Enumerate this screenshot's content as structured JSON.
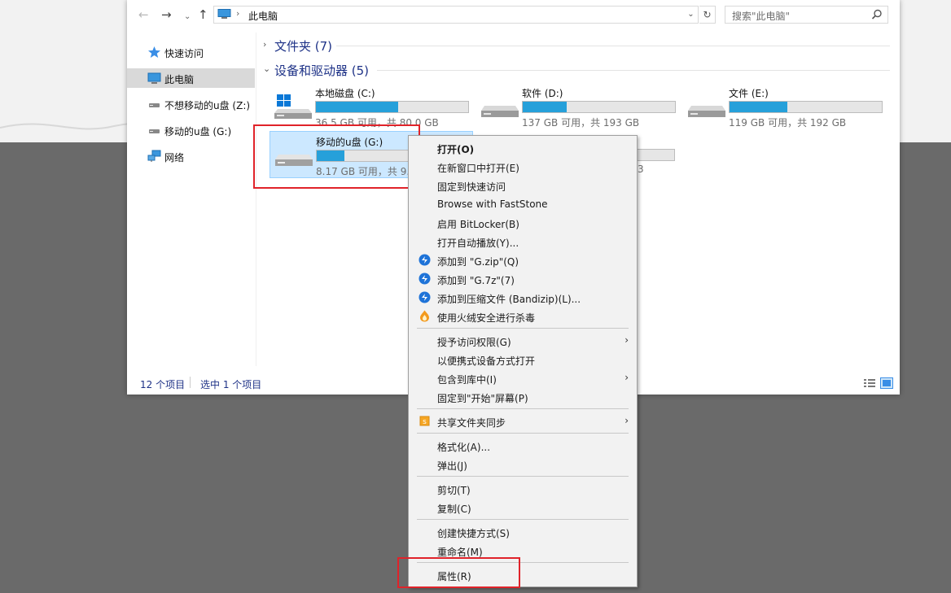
{
  "address": {
    "path": "此电脑",
    "search_placeholder": "搜索\"此电脑\""
  },
  "sidebar": {
    "items": [
      {
        "label": "快速访问"
      },
      {
        "label": "此电脑"
      },
      {
        "label": "不想移动的u盘 (Z:)"
      },
      {
        "label": "移动的u盘 (G:)"
      },
      {
        "label": "网络"
      }
    ]
  },
  "content": {
    "folders_header": "文件夹 (7)",
    "devices_header": "设备和驱动器 (5)",
    "drives": [
      {
        "name": "本地磁盘 (C:)",
        "free": "36.5 GB 可用，共 80.0 GB",
        "used_fraction": 0.54
      },
      {
        "name": "软件 (D:)",
        "free": "137 GB 可用，共 193 GB",
        "used_fraction": 0.29
      },
      {
        "name": "文件 (E:)",
        "free": "119 GB 可用，共 192 GB",
        "used_fraction": 0.38
      },
      {
        "name": "移动的u盘 (G:)",
        "free": "8.17 GB 可用，共 9.9",
        "used_fraction": 0.18
      }
    ],
    "hidden_drive_fragment": "3"
  },
  "status": {
    "count": "12 个项目",
    "selected": "选中 1 个项目"
  },
  "context_menu": {
    "items": [
      "打开(O)",
      "在新窗口中打开(E)",
      "固定到快速访问",
      "Browse with FastStone",
      "启用 BitLocker(B)",
      "打开自动播放(Y)...",
      "添加到 \"G.zip\"(Q)",
      "添加到 \"G.7z\"(7)",
      "添加到压缩文件 (Bandizip)(L)...",
      "使用火绒安全进行杀毒",
      "授予访问权限(G)",
      "以便携式设备方式打开",
      "包含到库中(I)",
      "固定到\"开始\"屏幕(P)",
      "共享文件夹同步",
      "格式化(A)...",
      "弹出(J)",
      "剪切(T)",
      "复制(C)",
      "创建快捷方式(S)",
      "重命名(M)",
      "属性(R)"
    ]
  },
  "colors": {
    "accent": "#26a0da",
    "highlight_box": "#e0232a",
    "selected_bg": "#cce8ff"
  }
}
